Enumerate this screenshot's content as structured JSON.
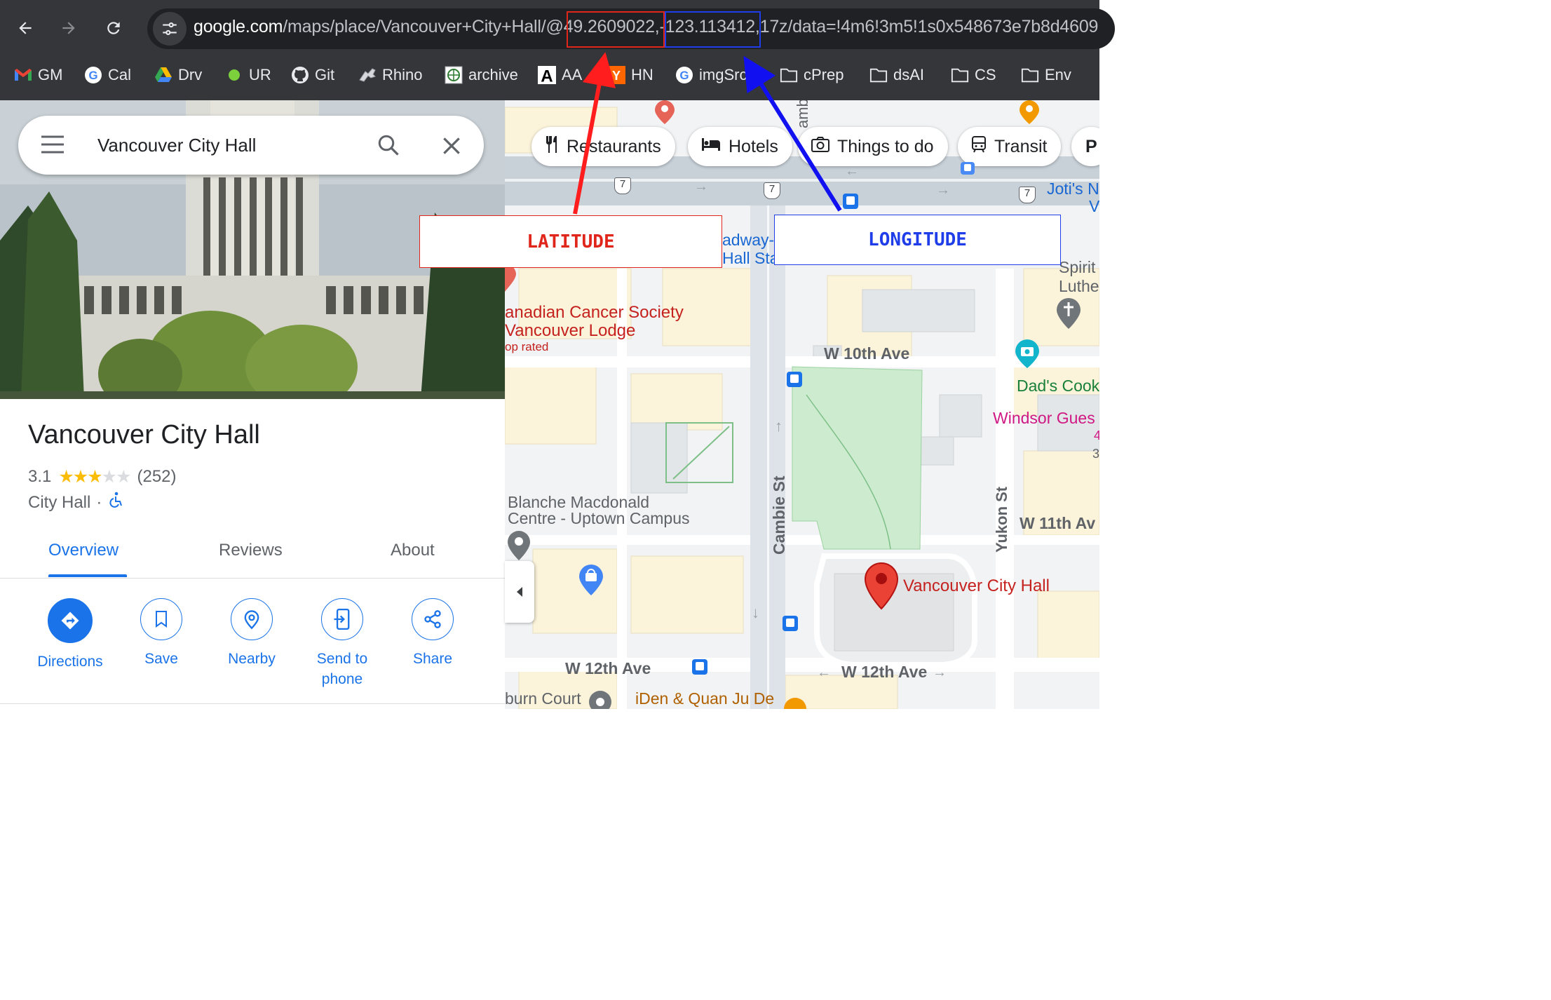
{
  "browser": {
    "url_host": "google.com",
    "url_path_before": "/maps/place/Vancouver+City+Hall/@",
    "url_latitude": "49.2609022",
    "url_longitude": "-123.113412",
    "url_path_after": ",17z/data=!4m6!3m5!1s0x548673e7b8d4609",
    "bookmarks": [
      {
        "label": "GM",
        "icon": "gmail-icon"
      },
      {
        "label": "Cal",
        "icon": "google-icon"
      },
      {
        "label": "Drv",
        "icon": "drive-icon"
      },
      {
        "label": "UR",
        "icon": "green-dot-icon"
      },
      {
        "label": "Git",
        "icon": "github-icon"
      },
      {
        "label": "Rhino",
        "icon": "rhino-icon"
      },
      {
        "label": "archive",
        "icon": "archive-icon"
      },
      {
        "label": "AA",
        "icon": "letter-a-icon"
      },
      {
        "label": "HN",
        "icon": "hacker-news-icon"
      },
      {
        "label": "imgSrc",
        "icon": "google-icon"
      },
      {
        "label": "cPrep",
        "icon": "folder-icon"
      },
      {
        "label": "dsAI",
        "icon": "folder-icon"
      },
      {
        "label": "CS",
        "icon": "folder-icon"
      },
      {
        "label": "Env",
        "icon": "folder-icon"
      }
    ]
  },
  "search": {
    "query": "Vancouver City Hall"
  },
  "place": {
    "title": "Vancouver City Hall",
    "rating": "3.1",
    "stars_filled": 3,
    "stars_total": 5,
    "review_count": "(252)",
    "category": "City Hall",
    "separator": "·"
  },
  "tabs": [
    {
      "label": "Overview",
      "active": true
    },
    {
      "label": "Reviews",
      "active": false
    },
    {
      "label": "About",
      "active": false
    }
  ],
  "actions": [
    {
      "label": "Directions",
      "icon": "directions-icon"
    },
    {
      "label": "Save",
      "icon": "bookmark-icon"
    },
    {
      "label": "Nearby",
      "icon": "nearby-icon"
    },
    {
      "label": "Send to phone",
      "icon": "send-to-phone-icon"
    },
    {
      "label": "Share",
      "icon": "share-icon"
    }
  ],
  "map": {
    "chips": [
      "Restaurants",
      "Hotels",
      "Things to do",
      "Transit",
      "P"
    ],
    "labels": {
      "cancer_society_1": "anadian Cancer Society",
      "cancer_society_2": "Vancouver Lodge",
      "cancer_society_3": "op rated",
      "w10": "W 10th Ave",
      "w11": "W 11th Av",
      "w12a": "W 12th Ave",
      "w12b": "W 12th Ave",
      "cambie": "Cambie St",
      "cambie_top": "amb",
      "yukon": "Yukon St",
      "blanche1": "Blanche Macdonald",
      "blanche2": "Centre - Uptown Campus",
      "city_hall_pin": "Vancouver City Hall",
      "dads": "Dad's Cook",
      "windsor": "Windsor Gues",
      "spirit1": "Spirit",
      "spirit2": "Luthe",
      "jotis1": "Joti's N",
      "jotis2": "V",
      "broadway1": "adway-",
      "broadway2": "Hall Sta",
      "burn_court": "burn Court",
      "iden": "iDen & Quan Ju De",
      "route7": "7",
      "num4": "4",
      "num3": "3"
    }
  },
  "annotations": {
    "latitude": "LATITUDE",
    "longitude": "LONGITUDE",
    "latitude_color": "#e0251b",
    "longitude_color": "#1f3de8"
  },
  "colors": {
    "accent": "#1a73e8",
    "pin": "#ea4335",
    "star": "#fbbc04"
  }
}
